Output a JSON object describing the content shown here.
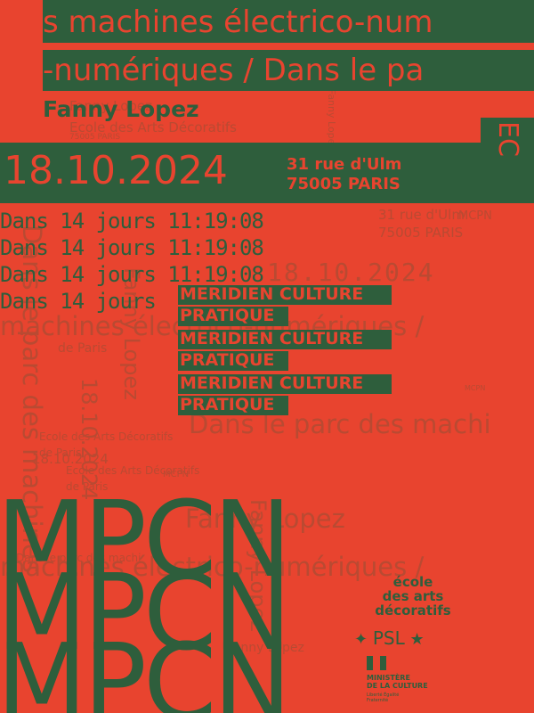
{
  "colors": {
    "background": "#e8442f",
    "green": "#2e5e3c"
  },
  "title": {
    "line1": "s machines électrico-num",
    "line2": "-numériques / Dans le pa"
  },
  "author": "Fanny Lopez",
  "institution": "Ecole des Arts Décoratifs",
  "institution_city": "75005 PARIS",
  "date": "18.10.2024",
  "address": {
    "line1": "31 rue d'Ulm",
    "line2": "75005 PARIS"
  },
  "corner_tag": "EC",
  "countdown": "Dans 14 jours 11:19:08",
  "countdown_short": "Dans 14 jours",
  "meridien": {
    "line1": "MERIDIEN CULTURE",
    "line2": "PRATIQUE"
  },
  "bg_phrases": {
    "numeriques": "machines électrico-numériques /",
    "parc": "Dans le parc des machi",
    "de_paris": "de Paris",
    "lopez": "Fanny Lopez",
    "mcpn": "MCPN",
    "ecole_short": "Ecole des Arts Décoratifs",
    "vertical_parc": "Dans le parc des machines",
    "date_vertical": "18.10.2024",
    "fanny_vertical": "Fanny Lopez"
  },
  "big_mark": "MPCN",
  "logos": {
    "ead": {
      "line1": "école",
      "line2": "des arts",
      "line3": "décoratifs"
    },
    "psl": "PSL",
    "ministere": {
      "line1": "MINISTÈRE",
      "line2": "DE LA CULTURE",
      "line3": "Liberté Égalité Fraternité"
    }
  }
}
